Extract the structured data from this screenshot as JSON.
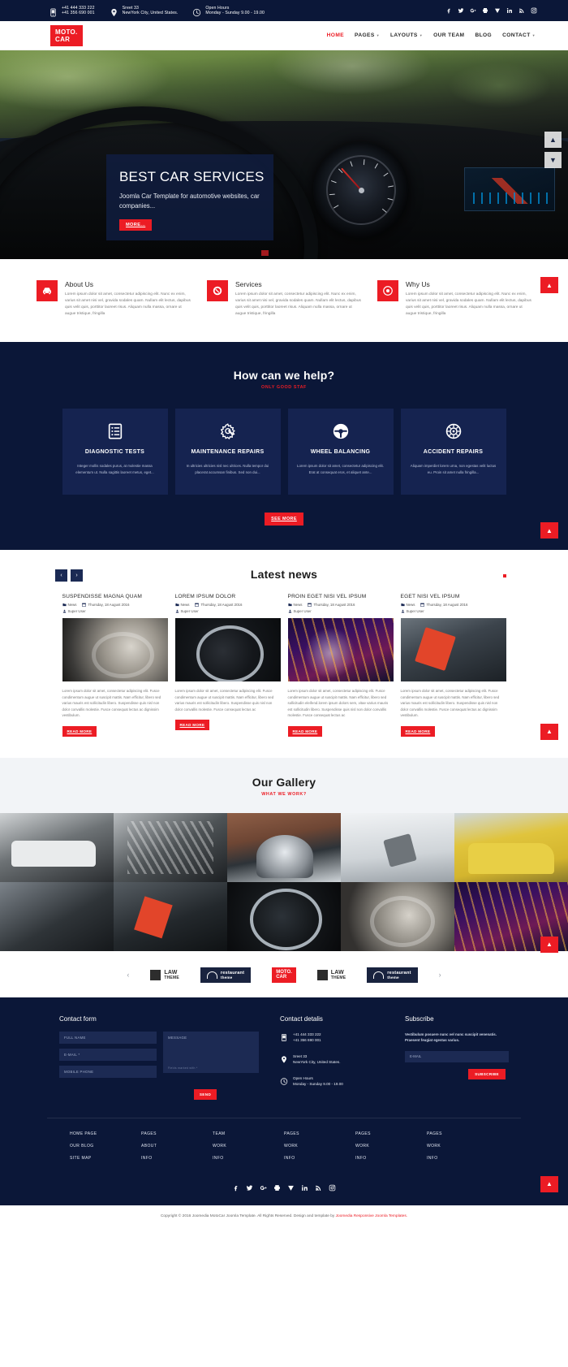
{
  "topbar": {
    "phone1": "+41 444 333 222",
    "phone2": "+41 356 690 001",
    "address1": "Sreet 33",
    "address2": "NewYork City, United States.",
    "hours1": "Open Hours",
    "hours2": "Monday - Sunday 9.00 - 19.00",
    "social": [
      "facebook",
      "twitter",
      "google-plus",
      "print",
      "vimeo",
      "linkedin",
      "rss",
      "instagram"
    ]
  },
  "header": {
    "logo_line1": "MOTO.",
    "logo_line2": "CAR",
    "nav": [
      {
        "label": "HOME",
        "active": true,
        "caret": false
      },
      {
        "label": "PAGES",
        "active": false,
        "caret": true
      },
      {
        "label": "LAYOUTS",
        "active": false,
        "caret": true
      },
      {
        "label": "OUR TEAM",
        "active": false,
        "caret": false
      },
      {
        "label": "BLOG",
        "active": false,
        "caret": false
      },
      {
        "label": "CONTACT",
        "active": false,
        "caret": true
      }
    ]
  },
  "hero": {
    "title": "BEST CAR SERVICES",
    "subtitle": "Joomla Car Template for automotive websites, car companies...",
    "button": "MORE...",
    "arrow_up": "▲",
    "arrow_down": "▼"
  },
  "features": [
    {
      "icon": "car-icon",
      "title": "About Us",
      "text": "Lorem ipsum dolor sit amet, consectetur adipiscing elit. Nunc ex enim, varius sit amet nisi vel, gravida sodales quam. Nullam elit lectus, dapibus quis velit quis, porttitor laoreet risus. Aliquam nulla massa, ornare ut augue tristique, fringilla"
    },
    {
      "icon": "wrench-gear-icon",
      "title": "Services",
      "text": "Lorem ipsum dolor sit amet, consectetur adipiscing elit. Nunc ex enim, varius sit amet nisi vel, gravida sodales quam. Nullam elit lectus, dapibus quis velit quis, porttitor laoreet risus. Aliquam nulla massa, ornare ut augue tristique, fringilla"
    },
    {
      "icon": "target-icon",
      "title": "Why Us",
      "text": "Lorem ipsum dolor sit amet, consectetur adipiscing elit. Nunc ex enim, varius sit amet nisi vel, gravida sodales quam. Nullam elit lectus, dapibus quis velit quis, porttitor laoreet risus. Aliquam nulla massa, ornare ut augue tristique, fringilla"
    }
  ],
  "help": {
    "title": "How can we help?",
    "subtitle": "ONLY GOOD STAF",
    "cards": [
      {
        "icon": "checklist-icon",
        "title": "DIAGNOSTIC TESTS",
        "text": "Integer mollis sodales purus, at molestie massa elementum ut. Nulla sagittis laoreet metus, eget..."
      },
      {
        "icon": "wrench-gear-icon",
        "title": "MAINTENANCE REPAIRS",
        "text": "In ultricies ultricies nisl nec ultrices. Nulla tempor dui placerat accumsan finibus. Sed non dui..."
      },
      {
        "icon": "steering-wheel-icon",
        "title": "WHEEL BALANCING",
        "text": "Lorem ipsum dolor sit amet, consectetur adipiscing elit. Erat at consequat eros, et aliquet ante..."
      },
      {
        "icon": "tire-icon",
        "title": "ACCIDENT REPAIRS",
        "text": "Aliquam imperdiet lorem urna, non egestas velit luctus eu. Proin sit amet nulla fringilla..."
      }
    ],
    "button": "SEE MORE"
  },
  "news": {
    "title": "Latest news",
    "prev": "‹",
    "next": "›",
    "items": [
      {
        "title": "SUSPENDISSE MAGNA QUAM",
        "category": "News",
        "date": "Thursday, 18 August 2016",
        "author": "Super User",
        "body": "Lorem ipsum dolor sit amet, consectetur adipiscing elit. Fusce condimentum augue ut suscipit mattis. Nam efficitur, libero sed varius mauris est sollicitudin libero. Suspendisse quis nisl non dolor convallis molestie. Fusce consequat lectus ac dignissim vestibulum.",
        "readmore": "READ MORE"
      },
      {
        "title": "LOREM IPSUM DOLOR",
        "category": "News",
        "date": "Thursday, 18 August 2016",
        "author": "Super User",
        "body": "Lorem ipsum dolor sit amet, consectetur adipiscing elit. Fusce condimentum augue ut suscipit mattis. Nam efficitur, libero sed varius mauris est sollicitudin libero. Suspendisse quis nisl non dolor convallis molestie. Fusce consequat lectus ac",
        "readmore": "READ MORE"
      },
      {
        "title": "PROIN EGET NISI VEL IPSUM",
        "category": "News",
        "date": "Thursday, 18 August 2016",
        "author": "Super User",
        "body": "Lorem ipsum dolor sit amet, consectetur adipiscing elit. Fusce condimentum augue ut suscipit mattis. Nam efficitur, libero sed sollicitudin eleifend.lorem ipsum dolors sem, vitae varius mauris est sollicitudin libero. Suspendisse quis nisl non dolor convallis molestie. Fusce consequat lectus ac",
        "readmore": "READ MORE"
      },
      {
        "title": "EGET NISI VEL IPSUM",
        "category": "News",
        "date": "Thursday, 18 August 2016",
        "author": "Super User",
        "body": "Lorem ipsum dolor sit amet, consectetur adipiscing elit. Fusce condimentum augue ut suscipit mattis. Nam efficitur, libero sed varius mauris est sollicitudin libero. Suspendisse quis nisl non dolor convallis molestie. Fusce consequat lectus ac dignissim vestibulum.",
        "readmore": "READ MORE"
      }
    ]
  },
  "gallery": {
    "title": "Our Gallery",
    "subtitle": "WHAT WE WORK?"
  },
  "brands": {
    "prev": "‹",
    "next": "›",
    "items": [
      {
        "style": "box",
        "line1": "LAW",
        "line2": "THEME"
      },
      {
        "style": "plate",
        "line1": "restaurant",
        "line2": "theme"
      },
      {
        "style": "red",
        "line1": "MOTO.",
        "line2": "CAR"
      },
      {
        "style": "box",
        "line1": "LAW",
        "line2": "THEME"
      },
      {
        "style": "plate",
        "line1": "restaurant",
        "line2": "theme"
      }
    ]
  },
  "footer": {
    "contact_form": {
      "heading": "Contact form",
      "full_name_placeholder": "FULL NAME",
      "email_placeholder": "E-MAIL *",
      "phone_placeholder": "MOBILE PHONE",
      "message_placeholder": "MESSAGE",
      "required_note": "Fields marked with *",
      "send_label": "SEND"
    },
    "contact_details": {
      "heading": "Contact detalis",
      "phone1": "+41 444 333 222",
      "phone2": "+41 356 690 001",
      "address1": "Sreet 33",
      "address2": "NewYork City, United States.",
      "hours1": "Open Hours",
      "hours2": "Monday - Sunday 9.00 - 19.00"
    },
    "subscribe": {
      "heading": "Subscribe",
      "text": "Vestibulum posuere nunc vel nunc suscipit venenatis. Praesent feugiat egestas varius.",
      "email_placeholder": "E-MAIL",
      "button": "SUBSCRIBE"
    },
    "link_columns": [
      [
        "HOME PAGE",
        "OUR BLOG",
        "SITE MAP"
      ],
      [
        "PAGES",
        "ABOUT",
        "INFO"
      ],
      [
        "TEAM",
        "WORK",
        "INFO"
      ],
      [
        "PAGES",
        "WORK",
        "INFO"
      ],
      [
        "PAGES",
        "WORK",
        "INFO"
      ],
      [
        "PAGES",
        "WORK",
        "INFO"
      ]
    ],
    "social": [
      "facebook",
      "twitter",
      "google-plus",
      "print",
      "vimeo",
      "linkedin",
      "rss",
      "instagram"
    ],
    "copyright_prefix": "Copyright © 2016 Joomedia MotoCar Joomla Template. All Rights Reserved. Design and template by ",
    "copyright_link": "Joomedia Responsive Joomla Templates."
  },
  "gotop": "▲"
}
